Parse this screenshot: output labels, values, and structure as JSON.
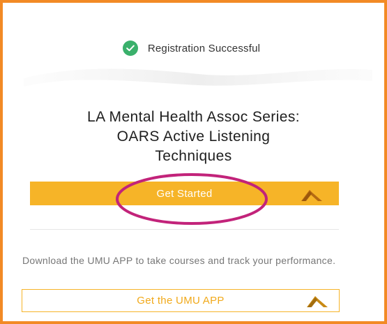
{
  "status": {
    "icon": "check-circle-icon",
    "text": "Registration Successful",
    "icon_color": "#3ab06b"
  },
  "course": {
    "title_line1": "LA Mental Health Assoc Series:",
    "title_line2": "OARS Active Listening",
    "title_line3": "Techniques"
  },
  "actions": {
    "get_started_label": "Get Started",
    "button_color": "#f6b428",
    "highlight_color": "#c2237a",
    "cursor_icon": "cursor-pointer-icon"
  },
  "promo": {
    "text": "Download the UMU APP to take courses and track your performance.",
    "app_button_label": "Get the UMU APP"
  },
  "frame": {
    "border_color": "#f28a25"
  }
}
